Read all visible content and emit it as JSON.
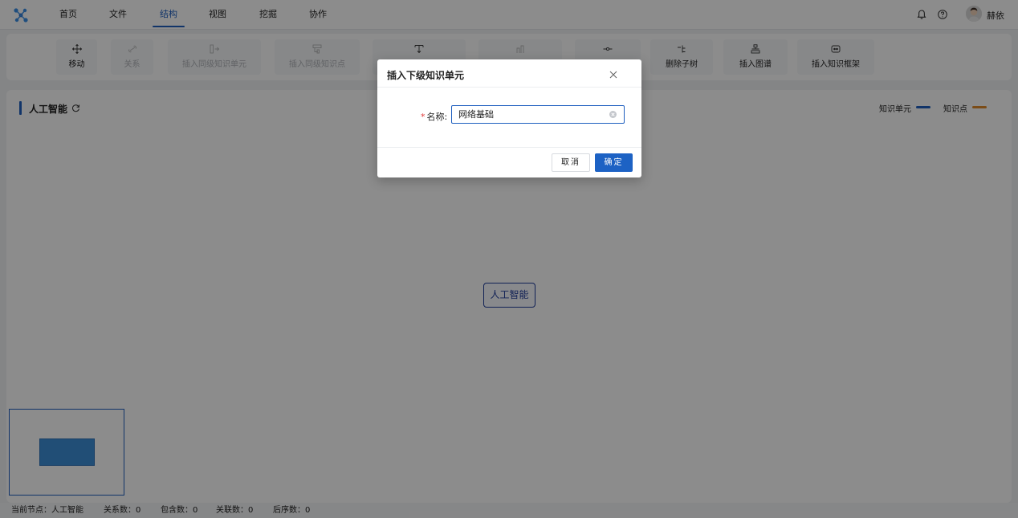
{
  "nav": {
    "items": [
      {
        "label": "首页"
      },
      {
        "label": "文件"
      },
      {
        "label": "结构"
      },
      {
        "label": "视图"
      },
      {
        "label": "挖掘"
      },
      {
        "label": "协作"
      }
    ],
    "active_index": 2,
    "username": "赫依",
    "icons": [
      "bell-icon",
      "help-icon"
    ]
  },
  "toolbar": {
    "items": [
      {
        "label": "移动",
        "icon": "move-icon",
        "enabled": true
      },
      {
        "label": "关系",
        "icon": "link-icon",
        "enabled": false
      },
      {
        "label": "插入同级知识单元",
        "icon": "insert-sibling-unit-icon",
        "enabled": false
      },
      {
        "label": "插入同级知识点",
        "icon": "insert-sibling-point-icon",
        "enabled": false
      },
      {
        "label": "",
        "icon": "insert-child-icon",
        "enabled": true
      },
      {
        "label": "",
        "icon": "insert-parent-icon",
        "enabled": false
      },
      {
        "label": "",
        "icon": "delete-node-icon",
        "enabled": true
      },
      {
        "label": "删除子树",
        "icon": "delete-subtree-icon",
        "enabled": true
      },
      {
        "label": "插入图谱",
        "icon": "insert-graph-icon",
        "enabled": true
      },
      {
        "label": "插入知识框架",
        "icon": "insert-framework-icon",
        "enabled": true
      }
    ]
  },
  "panel": {
    "title": "人工智能",
    "legend": [
      {
        "label": "知识单元",
        "color": "#1f5fbf"
      },
      {
        "label": "知识点",
        "color": "#e08a2a"
      }
    ],
    "center_node": "人工智能"
  },
  "status": {
    "current_node": "当前节点：人工智能",
    "relations": "关系数：0",
    "contains": "包含数：0",
    "associations": "关联数：0",
    "successors": "后序数：0"
  },
  "modal": {
    "title": "插入下级知识单元",
    "field_label": "名称:",
    "field_value": "网络基础",
    "cancel_label": "取消",
    "ok_label": "确定"
  },
  "colors": {
    "accent": "#1f5fbf",
    "unit": "#1f5fbf",
    "point": "#e08a2a",
    "required": "#e23a3a"
  }
}
